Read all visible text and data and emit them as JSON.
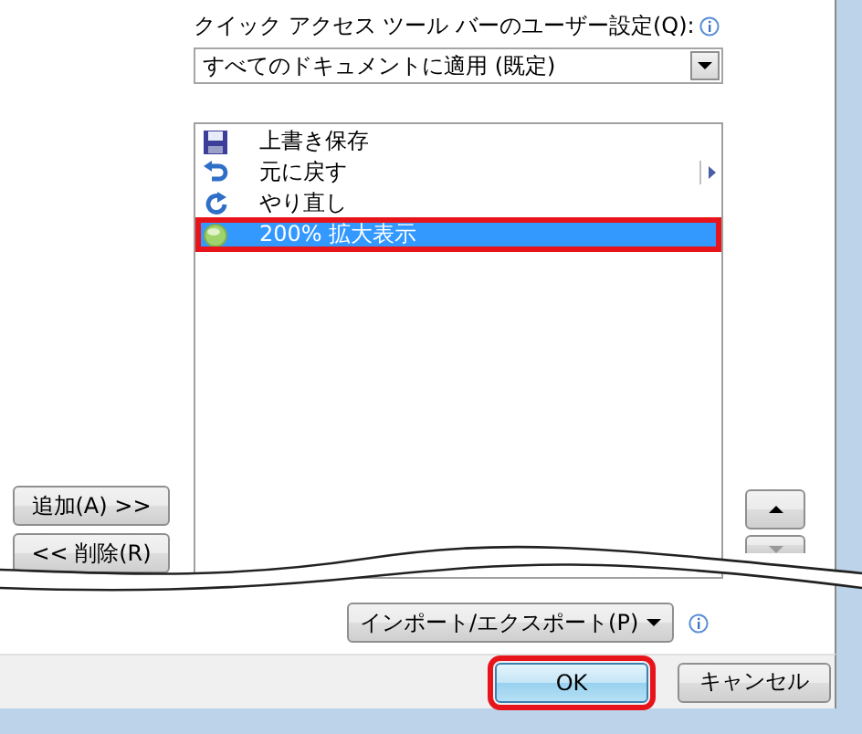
{
  "customize": {
    "label": "クイック アクセス ツール バーのユーザー設定(Q):",
    "scope_select": {
      "value": "すべてのドキュメントに適用 (既定)"
    }
  },
  "commands": [
    {
      "kind": "save",
      "label": "上書き保存",
      "selected": false,
      "submenu": false
    },
    {
      "kind": "undo",
      "label": "元に戻す",
      "selected": false,
      "submenu": true
    },
    {
      "kind": "redo",
      "label": "やり直し",
      "selected": false,
      "submenu": false
    },
    {
      "kind": "zoom",
      "label": "200% 拡大表示",
      "selected": true,
      "submenu": false
    }
  ],
  "add_button": "追加(A) >>",
  "remove_button": "<< 削除(R)",
  "import_export": "インポート/エクスポート(P)",
  "footer_buttons": [
    {
      "label": "OK",
      "highlighted": true
    },
    {
      "label": "キャンセル",
      "highlighted": false
    }
  ]
}
